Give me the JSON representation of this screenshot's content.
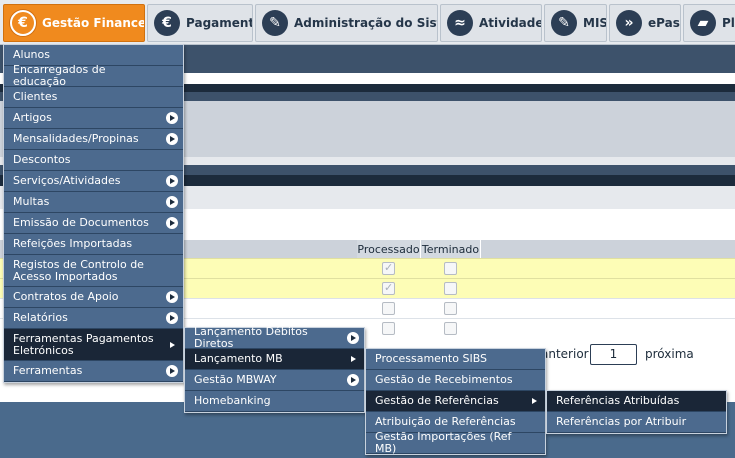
{
  "nav": {
    "tabs": [
      {
        "label": "Gestão Financeira",
        "icon": "euro-icon",
        "glyph": "€"
      },
      {
        "label": "Pagamentos",
        "icon": "euro-icon",
        "glyph": "€"
      },
      {
        "label": "Administração do Sistema",
        "icon": "admin-icon",
        "glyph": "✎"
      },
      {
        "label": "Atividades",
        "icon": "swimmer-icon",
        "glyph": "≈"
      },
      {
        "label": "MISI",
        "icon": "admin-icon",
        "glyph": "✎"
      },
      {
        "label": "ePass",
        "icon": "epass-icon",
        "glyph": "»"
      },
      {
        "label": "Pla",
        "icon": "book-icon",
        "glyph": "▰"
      }
    ]
  },
  "table": {
    "headers": {
      "processado": "Processado",
      "terminado": "Terminado"
    },
    "rows": [
      {
        "processado": true,
        "terminado": false
      },
      {
        "processado": true,
        "terminado": false
      },
      {
        "processado": false,
        "terminado": false
      },
      {
        "processado": false,
        "terminado": false
      }
    ]
  },
  "pager": {
    "prev": "anterior",
    "page": "1",
    "next": "próxima"
  },
  "menu1": {
    "items": [
      {
        "label": "Alunos",
        "sub": false
      },
      {
        "label": "Encarregados de educação",
        "sub": false
      },
      {
        "label": "Clientes",
        "sub": false
      },
      {
        "label": "Artigos",
        "sub": true
      },
      {
        "label": "Mensalidades/Propinas",
        "sub": true
      },
      {
        "label": "Descontos",
        "sub": false
      },
      {
        "label": "Serviços/Atividades",
        "sub": true
      },
      {
        "label": "Multas",
        "sub": true
      },
      {
        "label": "Emissão de Documentos",
        "sub": true
      },
      {
        "label": "Refeições Importadas",
        "sub": false
      },
      {
        "label": "Registos de Controlo de Acesso Importados",
        "sub": false
      },
      {
        "label": "Contratos de Apoio",
        "sub": true
      },
      {
        "label": "Relatórios",
        "sub": true
      },
      {
        "label": "Ferramentas Pagamentos Eletrónicos",
        "sub": true
      },
      {
        "label": "Ferramentas",
        "sub": true
      }
    ]
  },
  "menu2": {
    "items": [
      {
        "label": "Lançamento Débitos Diretos",
        "sub": true
      },
      {
        "label": "Lançamento MB",
        "sub": true
      },
      {
        "label": "Gestão MBWAY",
        "sub": true
      },
      {
        "label": "Homebanking",
        "sub": false
      }
    ]
  },
  "menu3": {
    "items": [
      {
        "label": "Processamento SIBS",
        "sub": false
      },
      {
        "label": "Gestão de Recebimentos",
        "sub": false
      },
      {
        "label": "Gestão de Referências",
        "sub": true
      },
      {
        "label": "Atribuição de Referências",
        "sub": false
      },
      {
        "label": "Gestão Importações (Ref MB)",
        "sub": false
      }
    ]
  },
  "menu4": {
    "items": [
      {
        "label": "Referências Atribuídas",
        "sub": false
      },
      {
        "label": "Referências por Atribuir",
        "sub": false
      }
    ]
  },
  "colors": {
    "accent": "#f08a1e",
    "menu_bg": "#4c6a8e",
    "menu_hot": "#1a2637",
    "nav_dark": "#2c3e55"
  }
}
